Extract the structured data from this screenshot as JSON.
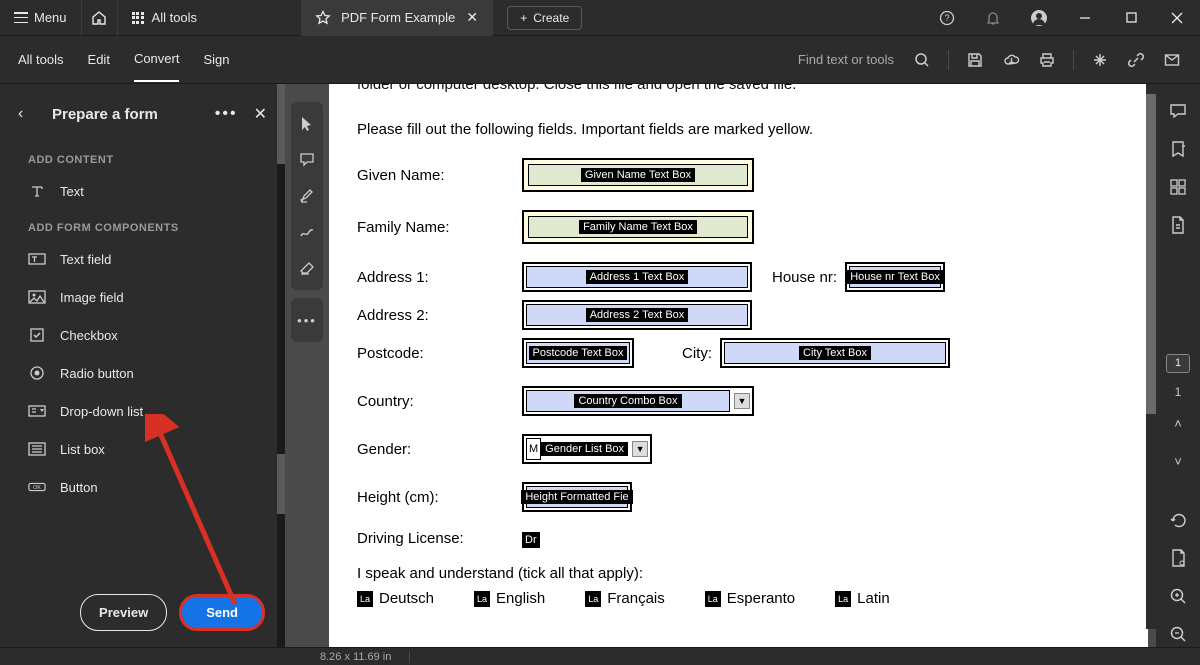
{
  "titlebar": {
    "menu_label": "Menu",
    "all_tools_label": "All tools",
    "tab_title": "PDF Form Example",
    "create_label": "Create"
  },
  "toolbar": {
    "items": [
      "All tools",
      "Edit",
      "Convert",
      "Sign"
    ],
    "search_placeholder": "Find text or tools"
  },
  "left_panel": {
    "title": "Prepare a form",
    "section_add_content": "ADD CONTENT",
    "text_item": "Text",
    "section_add_components": "ADD FORM COMPONENTS",
    "components": [
      {
        "label": "Text field"
      },
      {
        "label": "Image field"
      },
      {
        "label": "Checkbox"
      },
      {
        "label": "Radio button"
      },
      {
        "label": "Drop-down list"
      },
      {
        "label": "List box"
      },
      {
        "label": "Button"
      }
    ],
    "preview_label": "Preview",
    "send_label": "Send"
  },
  "document": {
    "partial_line": "folder or computer desktop. Close this file and open the saved file.",
    "instruction": "Please fill out the following fields. Important fields are marked yellow.",
    "labels": {
      "given_name": "Given Name:",
      "family_name": "Family Name:",
      "address1": "Address 1:",
      "house_nr": "House nr:",
      "address2": "Address 2:",
      "postcode": "Postcode:",
      "city": "City:",
      "country": "Country:",
      "gender": "Gender:",
      "height": "Height (cm):",
      "driving": "Driving License:",
      "languages_heading": "I speak and understand (tick all that apply):"
    },
    "field_names": {
      "given_name": "Given Name Text Box",
      "family_name": "Family Name Text Box",
      "address1": "Address 1 Text Box",
      "house_nr": "House nr Text Box",
      "address2": "Address 2 Text Box",
      "postcode": "Postcode Text Box",
      "city": "City Text Box",
      "country": "Country Combo Box",
      "gender_prefix": "M",
      "gender": "Gender List Box",
      "height": "Height Formatted Fie",
      "driving": "Dr"
    },
    "lang_check_tag": "La",
    "languages": [
      "Deutsch",
      "English",
      "Français",
      "Esperanto",
      "Latin"
    ]
  },
  "right_rail": {
    "current_page": "1",
    "total_pages": "1"
  },
  "status": {
    "dimensions": "8.26 x 11.69 in"
  }
}
